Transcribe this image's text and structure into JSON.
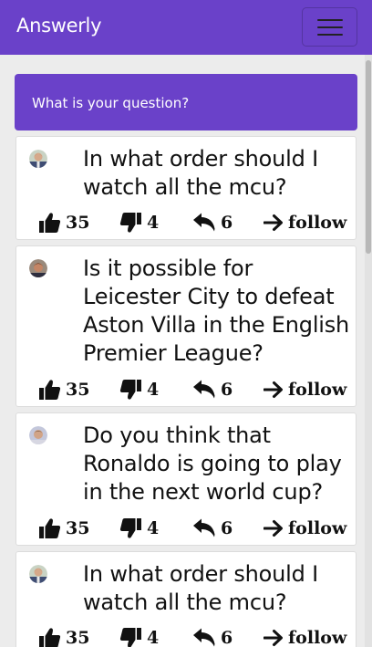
{
  "navbar": {
    "brand": "Answerly"
  },
  "ask": {
    "prompt": "What is your question?"
  },
  "questions": [
    {
      "text": "In what order should I watch all the mcu?",
      "likes": "35",
      "dislikes": "4",
      "replies": "6",
      "follow_label": "follow"
    },
    {
      "text": "Is it possible for Leicester City to defeat Aston Villa in the English Premier League?",
      "likes": "35",
      "dislikes": "4",
      "replies": "6",
      "follow_label": "follow"
    },
    {
      "text": "Do you think that Ronaldo is going to play in the next world cup?",
      "likes": "35",
      "dislikes": "4",
      "replies": "6",
      "follow_label": "follow"
    },
    {
      "text": "In what order should I watch all the mcu?",
      "likes": "35",
      "dislikes": "4",
      "replies": "6",
      "follow_label": "follow"
    }
  ],
  "icons": {
    "like": "thumbs-up-icon",
    "dislike": "thumbs-down-icon",
    "reply": "reply-icon",
    "follow": "arrow-right-icon",
    "menu": "hamburger-icon"
  },
  "colors": {
    "brand": "#6a41c9",
    "background": "#ececec",
    "card": "#ffffff"
  }
}
